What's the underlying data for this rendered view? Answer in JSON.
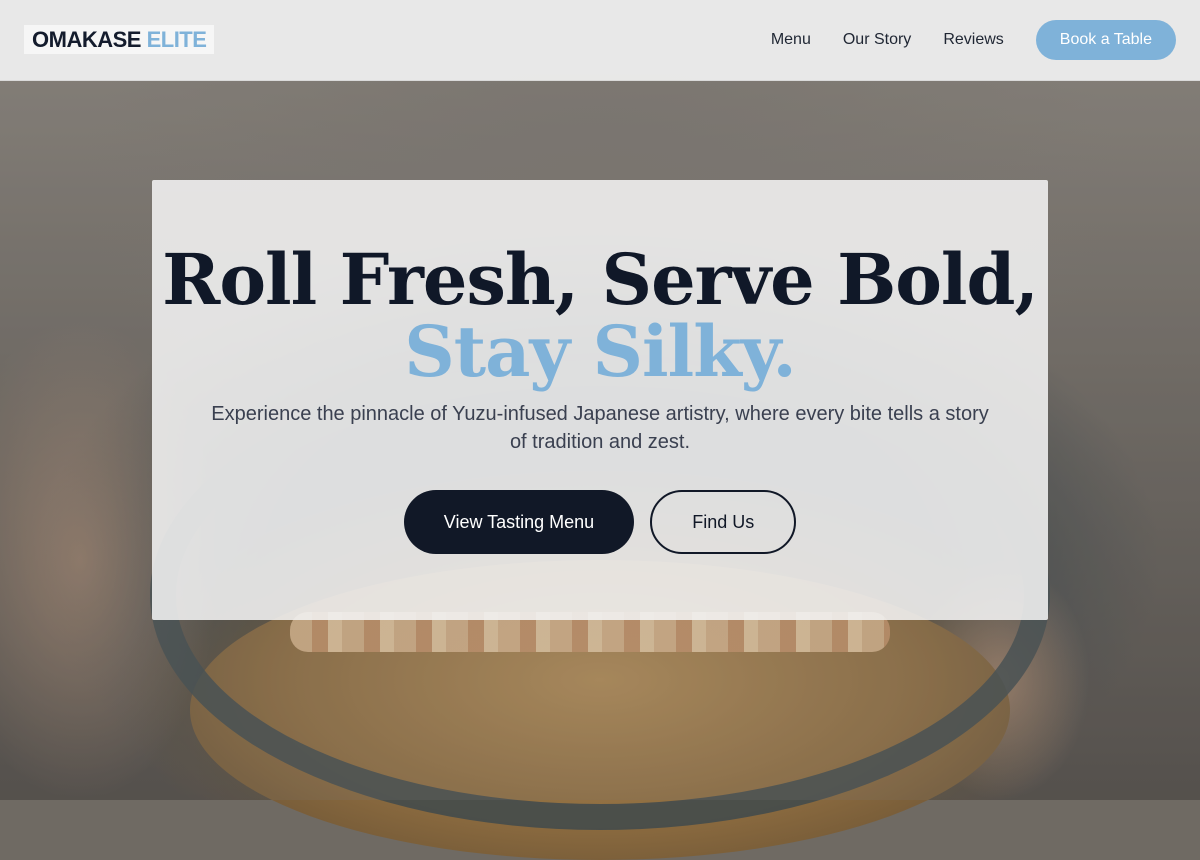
{
  "header": {
    "logo": {
      "primary": "OMAKASE",
      "accent": "ELITE"
    },
    "nav": [
      {
        "label": "Menu"
      },
      {
        "label": "Our Story"
      },
      {
        "label": "Reviews"
      }
    ],
    "cta_label": "Book a Table"
  },
  "hero": {
    "headline_line1": "Roll Fresh, Serve Bold,",
    "headline_line2": "Stay Silky.",
    "subtitle": "Experience the pinnacle of Yuzu-infused Japanese artistry, where every bite tells a story of tradition and zest.",
    "primary_button": "View Tasting Menu",
    "secondary_button": "Find Us",
    "background_image": "bowl-of-tonkatsu-photo"
  },
  "colors": {
    "accent": "#7fb2d9",
    "dark": "#111827",
    "header_bg": "#ebebeb"
  }
}
